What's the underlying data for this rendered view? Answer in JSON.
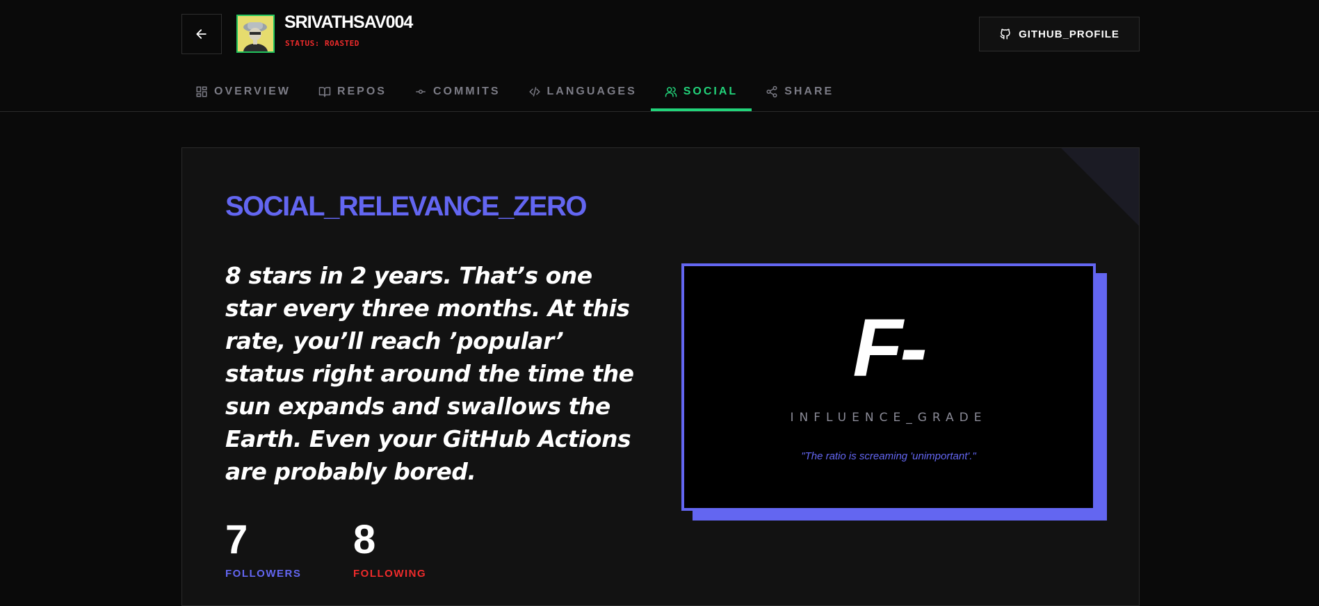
{
  "header": {
    "username": "SRIVATHSAV004",
    "status": "STATUS: ROASTED",
    "github_button_label": "GITHUB_PROFILE"
  },
  "tabs": [
    {
      "label": "OVERVIEW",
      "icon": "dashboard-icon"
    },
    {
      "label": "REPOS",
      "icon": "book-icon"
    },
    {
      "label": "COMMITS",
      "icon": "commit-icon"
    },
    {
      "label": "LANGUAGES",
      "icon": "code-icon"
    },
    {
      "label": "SOCIAL",
      "icon": "users-icon",
      "active": true
    },
    {
      "label": "SHARE",
      "icon": "share-icon"
    }
  ],
  "social": {
    "title": "SOCIAL_RELEVANCE_ZERO",
    "roast": "8 stars in 2 years. That’s one star every three months. At this rate, you’ll reach ’popular’ status right around the time the sun expands and swallows the Earth. Even your GitHub Actions are probably bored.",
    "followers": {
      "value": "7",
      "label": "FOLLOWERS"
    },
    "following": {
      "value": "8",
      "label": "FOLLOWING"
    },
    "grade": "F-",
    "grade_label": "INFLUENCE_GRADE",
    "grade_quote": "\"The ratio is screaming 'unimportant'.\""
  },
  "colors": {
    "accent": "#6366f1",
    "active_tab": "#22d37a",
    "danger": "#ef2b2b",
    "background": "#0a0a0a",
    "card": "#121212"
  }
}
